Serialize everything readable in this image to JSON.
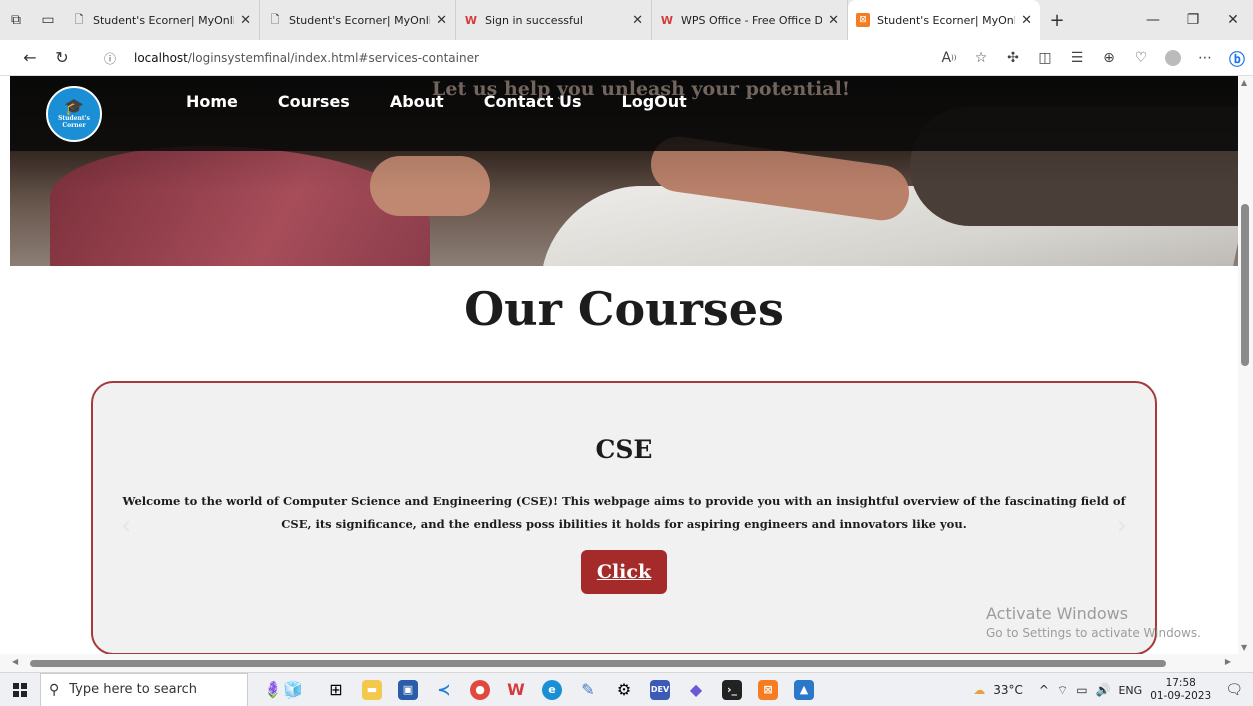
{
  "browser": {
    "tabs": [
      {
        "title": "Student's Ecorner| MyOnline",
        "icon": "page-icon"
      },
      {
        "title": "Student's Ecorner| MyOnline",
        "icon": "page-icon"
      },
      {
        "title": "Sign in successful",
        "icon": "wps-icon"
      },
      {
        "title": "WPS Office - Free Office Do",
        "icon": "wps-icon"
      },
      {
        "title": "Student's Ecorner| MyOnline",
        "icon": "xampp-icon",
        "active": true
      }
    ],
    "address": {
      "host": "localhost",
      "path": "/loginsystemfinal/index.html#services-container"
    }
  },
  "site": {
    "logo_text": "Student's Corner",
    "tagline": "Let us help you unleash your potential!",
    "nav": [
      "Home",
      "Courses",
      "About",
      "Contact Us",
      "LogOut"
    ],
    "section_title": "Our Courses",
    "course": {
      "title": "CSE",
      "description": "Welcome to the world of Computer Science and Engineering (CSE)! This webpage aims to provide you with an insightful overview of the fascinating field of CSE, its significance, and the endless poss ibilities it holds for aspiring engineers and innovators like you.",
      "button": "Click"
    }
  },
  "watermark": {
    "line1": "Activate Windows",
    "line2": "Go to Settings to activate Windows."
  },
  "taskbar": {
    "search_placeholder": "Type here to search",
    "weather": "33°C",
    "language": "ENG",
    "time": "17:58",
    "date": "01-09-2023"
  },
  "colors": {
    "accent": "#a52a2a",
    "card_bg": "#f1f1f1",
    "logo_blue": "#1b8fd6"
  }
}
